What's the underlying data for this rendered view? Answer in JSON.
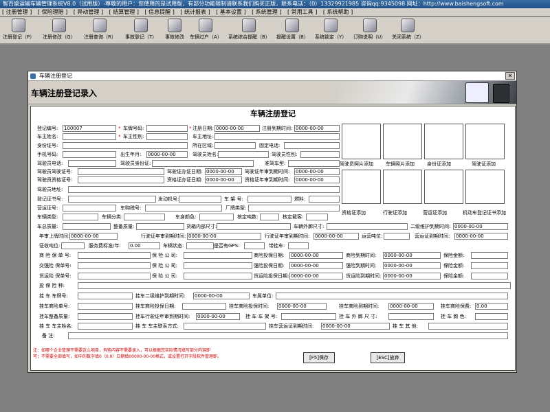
{
  "app": {
    "title": "智百盛运输车辆管理系统V8.0（试用版）-尊敬的用户：您使用的是试用版，有部分功能限制请联系我们购买正版，联系电话：（0）13329921985  咨询qq:9345098   网址：http://www.baishengsoft.com"
  },
  "menu": [
    "[ 注册管理 ]",
    "[ 保险理赔 ]",
    "[ 异动管理 ]",
    "[ 结算管理 ]",
    "[ 信息提醒 ]",
    "[ 统计报表 ]",
    "[ 基本设置 ]",
    "[ 系统管理 ]",
    "[ 常用工具 ]",
    "[ 系统帮助 ]"
  ],
  "toolbar": [
    {
      "label": "注册登记（P）",
      "icon": "register-icon"
    },
    {
      "label": "注册修改（Q）",
      "icon": "edit-icon"
    },
    {
      "label": "注册查询（R）",
      "icon": "query-icon"
    },
    {
      "label": "事故登记（T）",
      "icon": "accident-icon"
    },
    {
      "label": "事故修改",
      "icon": "accident-edit-icon"
    },
    {
      "label": "车辆过户（A）",
      "icon": "transfer-icon"
    },
    {
      "label": "系统综合提醒（B）",
      "icon": "alert-icon"
    },
    {
      "label": "提醒设置（B）",
      "icon": "settings-icon"
    },
    {
      "label": "系统锁定（Y）",
      "icon": "lock-icon"
    },
    {
      "label": "订购说明（U）",
      "icon": "order-icon"
    },
    {
      "label": "关闭系统（Z）",
      "icon": "close-system-icon"
    }
  ],
  "dialog": {
    "window_title": "车辆注册登记",
    "banner_title": "车辆注册登记录入",
    "form_title": "车辆注册登记",
    "close": "✕"
  },
  "labels": {
    "reg_no": "登记编号:",
    "plate_no": "车牌号码:",
    "reg_date": "注册日期:",
    "reg_expire": "注册到期时间:",
    "owner_name": "车主姓名:",
    "owner_sex": "车主性别:",
    "owner_addr": "车主地址:",
    "id_no": "身份证号:",
    "area": "所在区域:",
    "phone": "固定电话:",
    "mobile": "手机号码:",
    "birth": "出生年月:",
    "driver_name": "驾驶员姓名:",
    "driver_sex": "驾驶员性别:",
    "driver_phone": "驾驶员电话:",
    "driver_id": "驾驶员身份证:",
    "drive_type": "准驾车型:",
    "license_no": "驾驶员驾驶证号:",
    "license_date": "驾驶证办证日期:",
    "license_review": "驾驶证年审到期时间:",
    "qual_no": "驾驶员资格证号:",
    "qual_date": "资格证办证日期:",
    "qual_review": "资格证年审到期时间:",
    "driver_addr": "驾驶员地址:",
    "reg_cert": "登记证书号:",
    "engine": "发动机号:",
    "frame": "车 架 号:",
    "fuel": "燃料:",
    "op_cert": "营运证号:",
    "purchase_tax": "车购税号:",
    "factory_type": "厂牌类型:",
    "vehicle_type": "车辆类型:",
    "vehicle_class": "车辆分类:",
    "color": "车身颜色:",
    "tonnage": "核定吨数:",
    "seats": "核定载客:",
    "total_mass": "车总质量:",
    "curb_mass": "整备质量:",
    "box_size": "货箱内部尺寸:",
    "outer_size": "车辆外廓尺寸:",
    "maint2": "二级维护到期时间:",
    "inspect": "年审上牌时间:",
    "op_review": "行驶证年审到期时间:",
    "op_review2": "行驶证年审到期时间:",
    "transport": "运营吨位:",
    "op_cert_expire": "营运证到期时间:",
    "fee": "征收吨位:",
    "fee_std": "服务费标准/年:",
    "status": "车辆状态:",
    "gps": "是否有GPS:",
    "trailer": "带挂车:",
    "com_ins": "商 险 保 单 号:",
    "insurer": "保 险 公 司:",
    "com_start": "商险投保日期:",
    "com_end": "商险到期时间:",
    "premium": "保险金额:",
    "tra_ins": "交强险 保单号:",
    "tra_start": "强险投保日期:",
    "tra_end": "强险到期时间:",
    "cargo_ins": "货运险 保单号:",
    "cargo_start": "货运险投保日期:",
    "cargo_end": "货运险到期时间:",
    "ins_type": "投 保 险 种:",
    "tr_plate": "挂 车 车牌号:",
    "tr_maint": "挂车二级维护到期时间:",
    "tr_unit": "车属单位:",
    "tr_com": "挂车商险单号:",
    "tr_insdate": "挂车商险投保日期:",
    "tr_com_start": "挂车商险投保时间:",
    "tr_com_end": "挂车商险到期时间:",
    "tr_premium": "挂车商险保费:",
    "tr_tra": "挂车整备质量:",
    "tr_review": "挂车行驶证年审到期时间:",
    "tr_frame": "挂 车 车 架 号:",
    "tr_size": "挂 车 外 廓 尺 寸:",
    "tr_color": "挂 车 颜 色:",
    "tr_owner": "挂 车 车主姓名:",
    "tr_contact": "挂 车 车主联系方式:",
    "tr_op_expire": "挂车营运证到期时间:",
    "tr_other": "挂 车 其 他:",
    "remark": "备      注:"
  },
  "values": {
    "reg_no": "100007",
    "date_empty": "0000-00-00",
    "money": "0.00"
  },
  "photos": [
    "驾驶员照片添加",
    "车辆照片添加",
    "身份证添加",
    "驾驶证添加",
    "资格证添加",
    "行驶证添加",
    "营运证添加",
    "机动车登记证书添加"
  ],
  "buttons": {
    "save": "[F5]保存",
    "cancel": "[ESC]放弃"
  },
  "notes": [
    "注：如哪个企业管理不需要这么项目，有些内容不需要录入，可以根据您实际情况填写部分内容即",
    "可；不需要全部填写，如中的数字填0（0.0）日期填00000-00-00格式，或设置打开字段软件管理即。"
  ]
}
